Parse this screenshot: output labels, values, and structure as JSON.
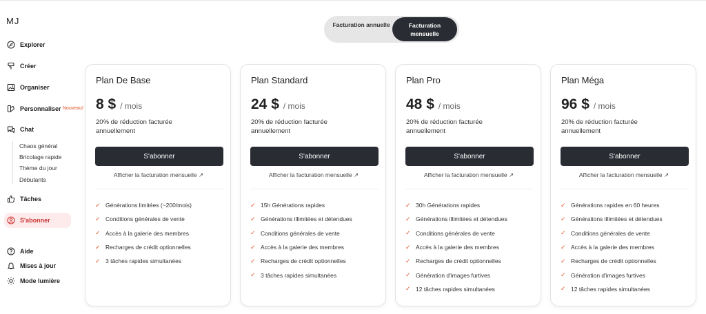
{
  "app": {
    "logo": "MJ"
  },
  "sidebar": {
    "items": [
      {
        "label": "Explorer",
        "icon": "compass-icon"
      },
      {
        "label": "Créer",
        "icon": "brush-icon"
      },
      {
        "label": "Organiser",
        "icon": "image-icon"
      },
      {
        "label": "Personnaliser",
        "icon": "palette-icon",
        "badge": "Nouveau!"
      },
      {
        "label": "Chat",
        "icon": "chat-icon"
      },
      {
        "label": "Tâches",
        "icon": "thumbs-up-icon"
      },
      {
        "label": "S'abonner",
        "icon": "user-circle-icon",
        "active": true
      }
    ],
    "chat_sub": [
      "Chaos général",
      "Bricolage rapide",
      "Thème du jour",
      "Débutants"
    ],
    "bottom": [
      {
        "label": "Aide",
        "icon": "help-icon"
      },
      {
        "label": "Mises à jour",
        "icon": "bell-icon"
      },
      {
        "label": "Mode lumière",
        "icon": "sun-icon"
      }
    ]
  },
  "billing_toggle": {
    "annual": "Facturation annuelle",
    "monthly_line1": "Facturation",
    "monthly_line2": "mensuelle",
    "selected": "monthly"
  },
  "plans": [
    {
      "name": "Plan De Base",
      "price": "8 $",
      "per": "/ mois",
      "discount": "20% de réduction facturée annuellement",
      "button": "S'abonner",
      "billing_link": "Afficher la facturation mensuelle ↗",
      "features": [
        "Générations limitées (~200/mois)",
        "Conditions générales de vente",
        "Accès à la galerie des membres",
        "Recharges de crédit optionnelles",
        "3 tâches rapides simultanées"
      ]
    },
    {
      "name": "Plan Standard",
      "price": "24 $",
      "per": "/ mois",
      "discount": "20% de réduction facturée annuellement",
      "button": "S'abonner",
      "billing_link": "Afficher la facturation mensuelle ↗",
      "features": [
        "15h Générations rapides",
        "Générations illimitées et détendues",
        "Conditions générales de vente",
        "Accès à la galerie des membres",
        "Recharges de crédit optionnelles",
        "3 tâches rapides simultanées"
      ]
    },
    {
      "name": "Plan Pro",
      "price": "48 $",
      "per": "/ mois",
      "discount": "20% de réduction facturée annuellement",
      "button": "S'abonner",
      "billing_link": "Afficher la facturation mensuelle ↗",
      "features": [
        "30h Générations rapides",
        "Générations illimitées et détendues",
        "Conditions générales de vente",
        "Accès à la galerie des membres",
        "Recharges de crédit optionnelles",
        "Génération d'images furtives",
        "12 tâches rapides simultanées"
      ]
    },
    {
      "name": "Plan Méga",
      "price": "96 $",
      "per": "/ mois",
      "discount": "20% de réduction facturée annuellement",
      "button": "S'abonner",
      "billing_link": "Afficher la facturation mensuelle ↗",
      "features": [
        "Générations rapides en 60 heures",
        "Générations illimitées et détendues",
        "Conditions générales de vente",
        "Accès à la galerie des membres",
        "Recharges de crédit optionnelles",
        "Génération d'images furtives",
        "12 tâches rapides simultanées"
      ]
    }
  ],
  "colors": {
    "accent": "#e0552a",
    "dark_button": "#2a2c33",
    "active_bg": "#fdeaea"
  }
}
